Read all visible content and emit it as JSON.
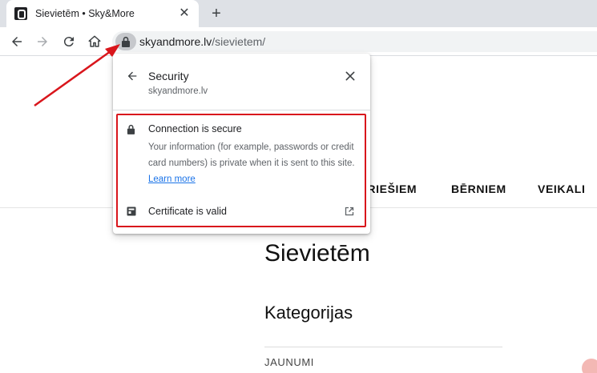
{
  "browser": {
    "tab": {
      "title": "Sievietēm • Sky&More",
      "close_glyph": "✕"
    },
    "new_tab_glyph": "+",
    "address": {
      "host": "skyandmore.lv",
      "path": "/sievietem/"
    }
  },
  "popup": {
    "title": "Security",
    "host": "skyandmore.lv",
    "connection": {
      "title": "Connection is secure",
      "description": "Your information (for example, passwords or credit card numbers) is private when it is sent to this site.",
      "learn_more": "Learn more"
    },
    "certificate": {
      "label": "Certificate is valid"
    }
  },
  "page": {
    "nav": [
      "VĪRIEŠIEM",
      "BĒRNIEM",
      "VEIKALI"
    ],
    "title": "Sievietēm",
    "section": "Kategorijas",
    "first_category": "JAUNUMI"
  },
  "colors": {
    "annotation": "#d9161c",
    "link": "#1a73e8",
    "lock_chip": "#c6c8cc"
  },
  "icons": [
    "back-icon",
    "forward-icon",
    "reload-icon",
    "home-icon",
    "lock-icon",
    "close-icon",
    "certificate-icon",
    "external-link-icon"
  ]
}
